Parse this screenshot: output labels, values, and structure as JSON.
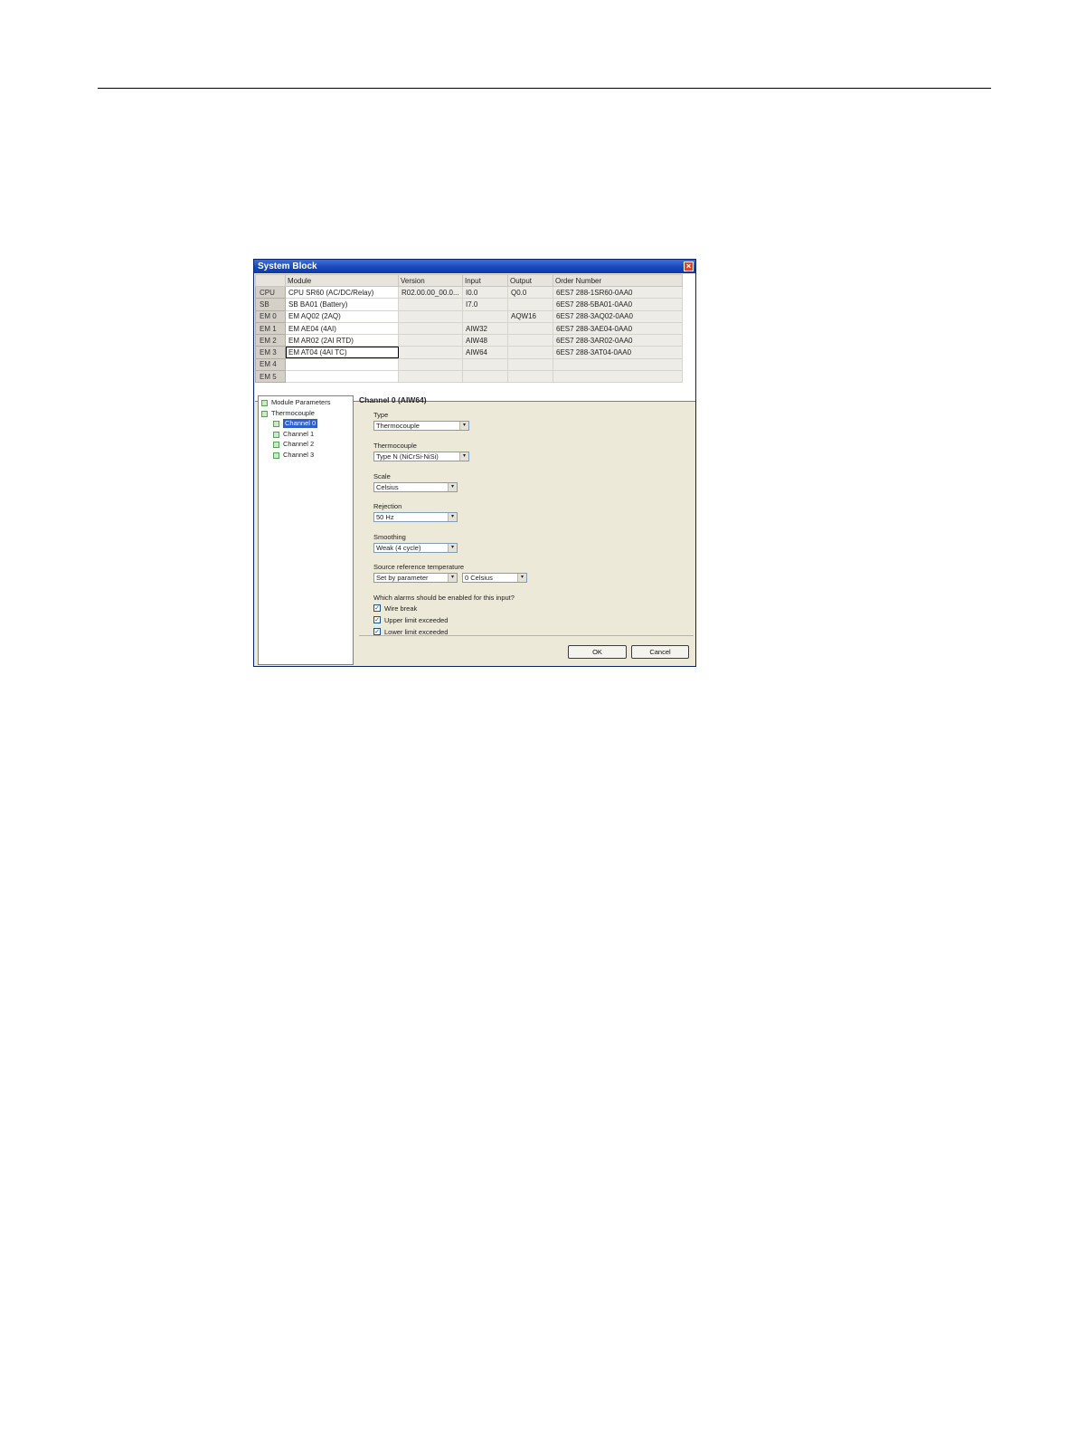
{
  "dialog": {
    "title": "System Block",
    "close_glyph": "×"
  },
  "module_table": {
    "columns": [
      "",
      "Module",
      "Version",
      "Input",
      "Output",
      "Order Number"
    ],
    "rows": [
      {
        "slot": "CPU",
        "module": "CPU SR60 (AC/DC/Relay)",
        "version": "R02.00.00_00.0...",
        "input": "I0.0",
        "output": "Q0.0",
        "order": "6ES7 288-1SR60-0AA0"
      },
      {
        "slot": "SB",
        "module": "SB BA01 (Battery)",
        "version": "",
        "input": "I7.0",
        "output": "",
        "order": "6ES7 288-5BA01-0AA0"
      },
      {
        "slot": "EM 0",
        "module": "EM AQ02 (2AQ)",
        "version": "",
        "input": "",
        "output": "AQW16",
        "order": "6ES7 288-3AQ02-0AA0"
      },
      {
        "slot": "EM 1",
        "module": "EM AE04 (4AI)",
        "version": "",
        "input": "AIW32",
        "output": "",
        "order": "6ES7 288-3AE04-0AA0"
      },
      {
        "slot": "EM 2",
        "module": "EM AR02 (2AI RTD)",
        "version": "",
        "input": "AIW48",
        "output": "",
        "order": "6ES7 288-3AR02-0AA0"
      },
      {
        "slot": "EM 3",
        "module": "EM AT04 (4AI TC)",
        "version": "",
        "input": "AIW64",
        "output": "",
        "order": "6ES7 288-3AT04-0AA0"
      },
      {
        "slot": "EM 4",
        "module": "",
        "version": "",
        "input": "",
        "output": "",
        "order": ""
      },
      {
        "slot": "EM 5",
        "module": "",
        "version": "",
        "input": "",
        "output": "",
        "order": ""
      }
    ]
  },
  "tree": {
    "items": [
      "Module Parameters",
      "Thermocouple",
      "Channel 0",
      "Channel 1",
      "Channel 2",
      "Channel 3"
    ]
  },
  "panel": {
    "title": "Channel 0 (AIW64)",
    "type_label": "Type",
    "type_value": "Thermocouple",
    "thermocouple_label": "Thermocouple",
    "thermocouple_value": "Type N (NiCrSi-NiSi)",
    "scale_label": "Scale",
    "scale_value": "Celsius",
    "rejection_label": "Rejection",
    "rejection_value": "50 Hz",
    "smoothing_label": "Smoothing",
    "smoothing_value": "Weak (4 cycle)",
    "source_ref_label": "Source reference temperature",
    "source_ref_value": "Set by parameter",
    "source_ref_temp_value": "0 Celsius",
    "alarms_label": "Which alarms should be enabled for this input?",
    "alarms": [
      {
        "label": "Wire break",
        "checked": true
      },
      {
        "label": "Upper limit exceeded",
        "checked": true
      },
      {
        "label": "Lower limit exceeded",
        "checked": true
      }
    ]
  },
  "buttons": {
    "ok": "OK",
    "cancel": "Cancel"
  },
  "icons": {
    "dropdown": "▾",
    "check": "✓"
  }
}
